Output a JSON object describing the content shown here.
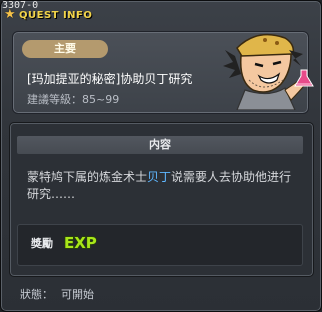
{
  "window": {
    "quest_id": "3307-0",
    "title": "QUEST INFO"
  },
  "quest": {
    "category": "主要",
    "name": "[玛加提亚的秘密]协助贝丁研究",
    "level_range": "建議等級：85~99",
    "npc_icon": "npc-portrait-icon"
  },
  "content": {
    "header": "内容",
    "desc_part1": "蒙特鸠下属的炼金术士",
    "desc_highlight": "贝丁",
    "desc_part2": "说需要人去协助他进行研究……"
  },
  "reward": {
    "label": "獎勵",
    "icon": "exp-icon",
    "icon_text": "EXP"
  },
  "status": {
    "label": "狀態：",
    "value": "可開始"
  },
  "colors": {
    "title": "#f2d44a",
    "badge": "#b49a6e",
    "highlight": "#5fb7ff",
    "exp": "#a8e61a"
  }
}
